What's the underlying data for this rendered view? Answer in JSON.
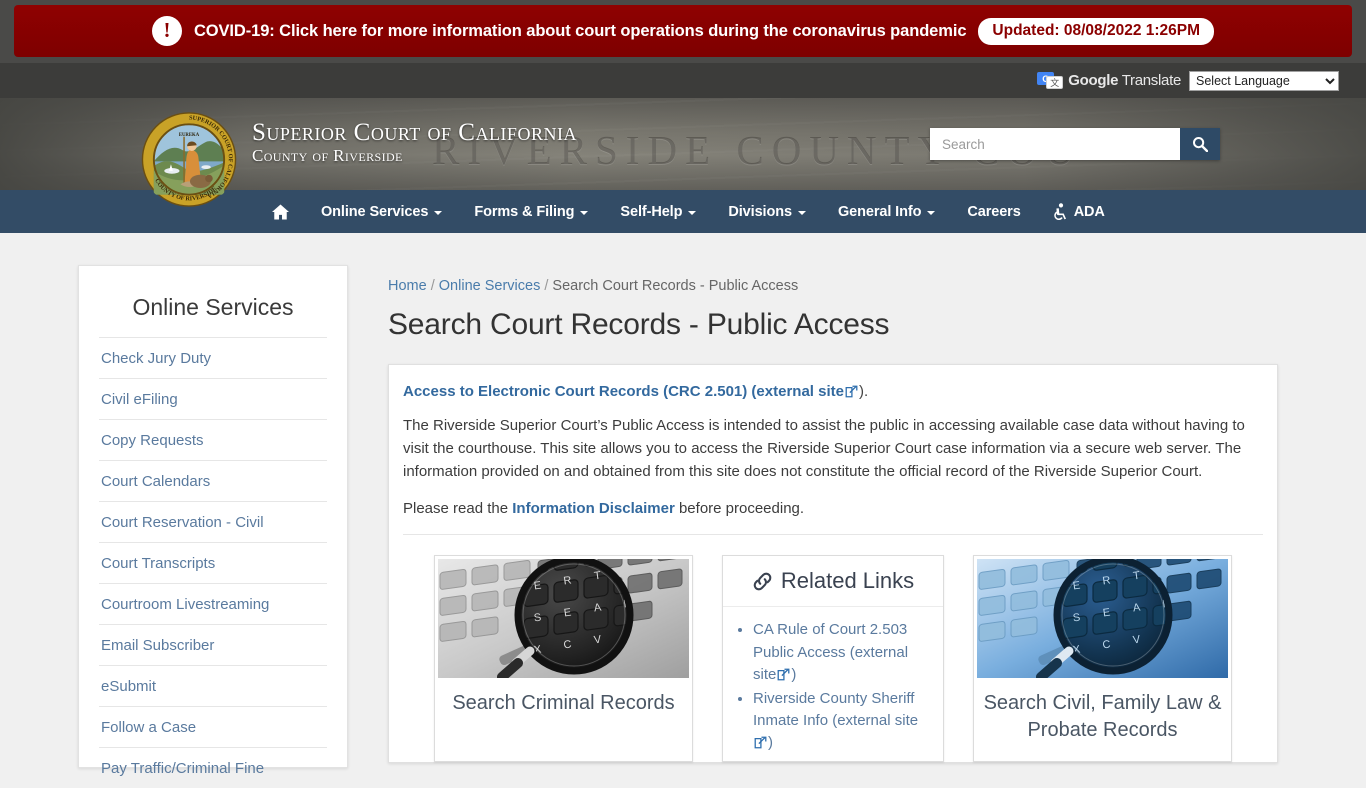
{
  "covid_banner": {
    "icon": "exclamation-circle-icon",
    "message": "COVID-19: Click here for more information about court operations during the coronavirus pandemic",
    "updated_badge": "Updated: 08/08/2022 1:26PM",
    "background_color": "#8b0000",
    "text_color": "#ffffff"
  },
  "translate_bar": {
    "logo_text_bold": "Google",
    "logo_text_light": " Translate",
    "logo_icon": "google-translate-icon",
    "select_value": "Select Language",
    "options": [
      "Select Language"
    ]
  },
  "masthead": {
    "seal_alt": "superior-court-of-california-county-of-riverside-seal",
    "title_line1": "Superior Court of California",
    "title_line2": "County of Riverside",
    "engraved_background_text": "RIVERSIDE COUNTY COU",
    "search": {
      "placeholder": "Search",
      "value": "",
      "button_icon": "search-icon",
      "button_color": "#2e4a66"
    }
  },
  "navbar": {
    "background_color": "#334c66",
    "items": [
      {
        "label": "",
        "icon": "home-icon",
        "caret": false
      },
      {
        "label": "Online Services",
        "icon": "",
        "caret": true
      },
      {
        "label": "Forms & Filing",
        "icon": "",
        "caret": true
      },
      {
        "label": "Self-Help",
        "icon": "",
        "caret": true
      },
      {
        "label": "Divisions",
        "icon": "",
        "caret": true
      },
      {
        "label": "General Info",
        "icon": "",
        "caret": true
      },
      {
        "label": "Careers",
        "icon": "",
        "caret": false
      },
      {
        "label": "ADA",
        "icon": "wheelchair-accessibility-icon",
        "caret": false
      }
    ]
  },
  "sidebar": {
    "title": "Online Services",
    "items": [
      {
        "label": "Check Jury Duty"
      },
      {
        "label": "Civil eFiling"
      },
      {
        "label": "Copy Requests"
      },
      {
        "label": "Court Calendars"
      },
      {
        "label": "Court Reservation - Civil"
      },
      {
        "label": "Court Transcripts"
      },
      {
        "label": "Courtroom Livestreaming"
      },
      {
        "label": "Email Subscriber"
      },
      {
        "label": "eSubmit"
      },
      {
        "label": "Follow a Case"
      },
      {
        "label": "Pay Traffic/Criminal Fine"
      }
    ]
  },
  "breadcrumb": {
    "home": "Home",
    "sep": "/",
    "section": "Online Services",
    "current": "Search Court Records - Public Access"
  },
  "page": {
    "title": "Search Court Records - Public Access",
    "lead_link_text": "Access to Electronic Court Records (CRC 2.501) (external site",
    "lead_link_tail": ").",
    "paragraph1": "The Riverside Superior Court’s Public Access is intended to assist the public in accessing available case data without having to visit the courthouse. This site allows you to access the Riverside Superior Court case information via a secure web server. The information provided on and obtained from this site does not constitute the official record of the Riverside Superior Court.",
    "paragraph2_before": "Please read the ",
    "paragraph2_link": "Information Disclaimer",
    "paragraph2_after": " before proceeding."
  },
  "cards": {
    "criminal": {
      "label": "Search Criminal Records",
      "image_alt": "magnifying-glass-over-keyboard-grayscale"
    },
    "related_links": {
      "heading": "Related Links",
      "heading_icon": "link-chain-icon",
      "links": [
        {
          "text": "CA Rule of Court 2.503 Public Access (external site",
          "tail": ")"
        },
        {
          "text": "Riverside County Sheriff Inmate Info (external site",
          "tail": ")"
        }
      ]
    },
    "civil": {
      "label": "Search Civil, Family Law & Probate Records",
      "image_alt": "magnifying-glass-over-keyboard-blue"
    }
  }
}
